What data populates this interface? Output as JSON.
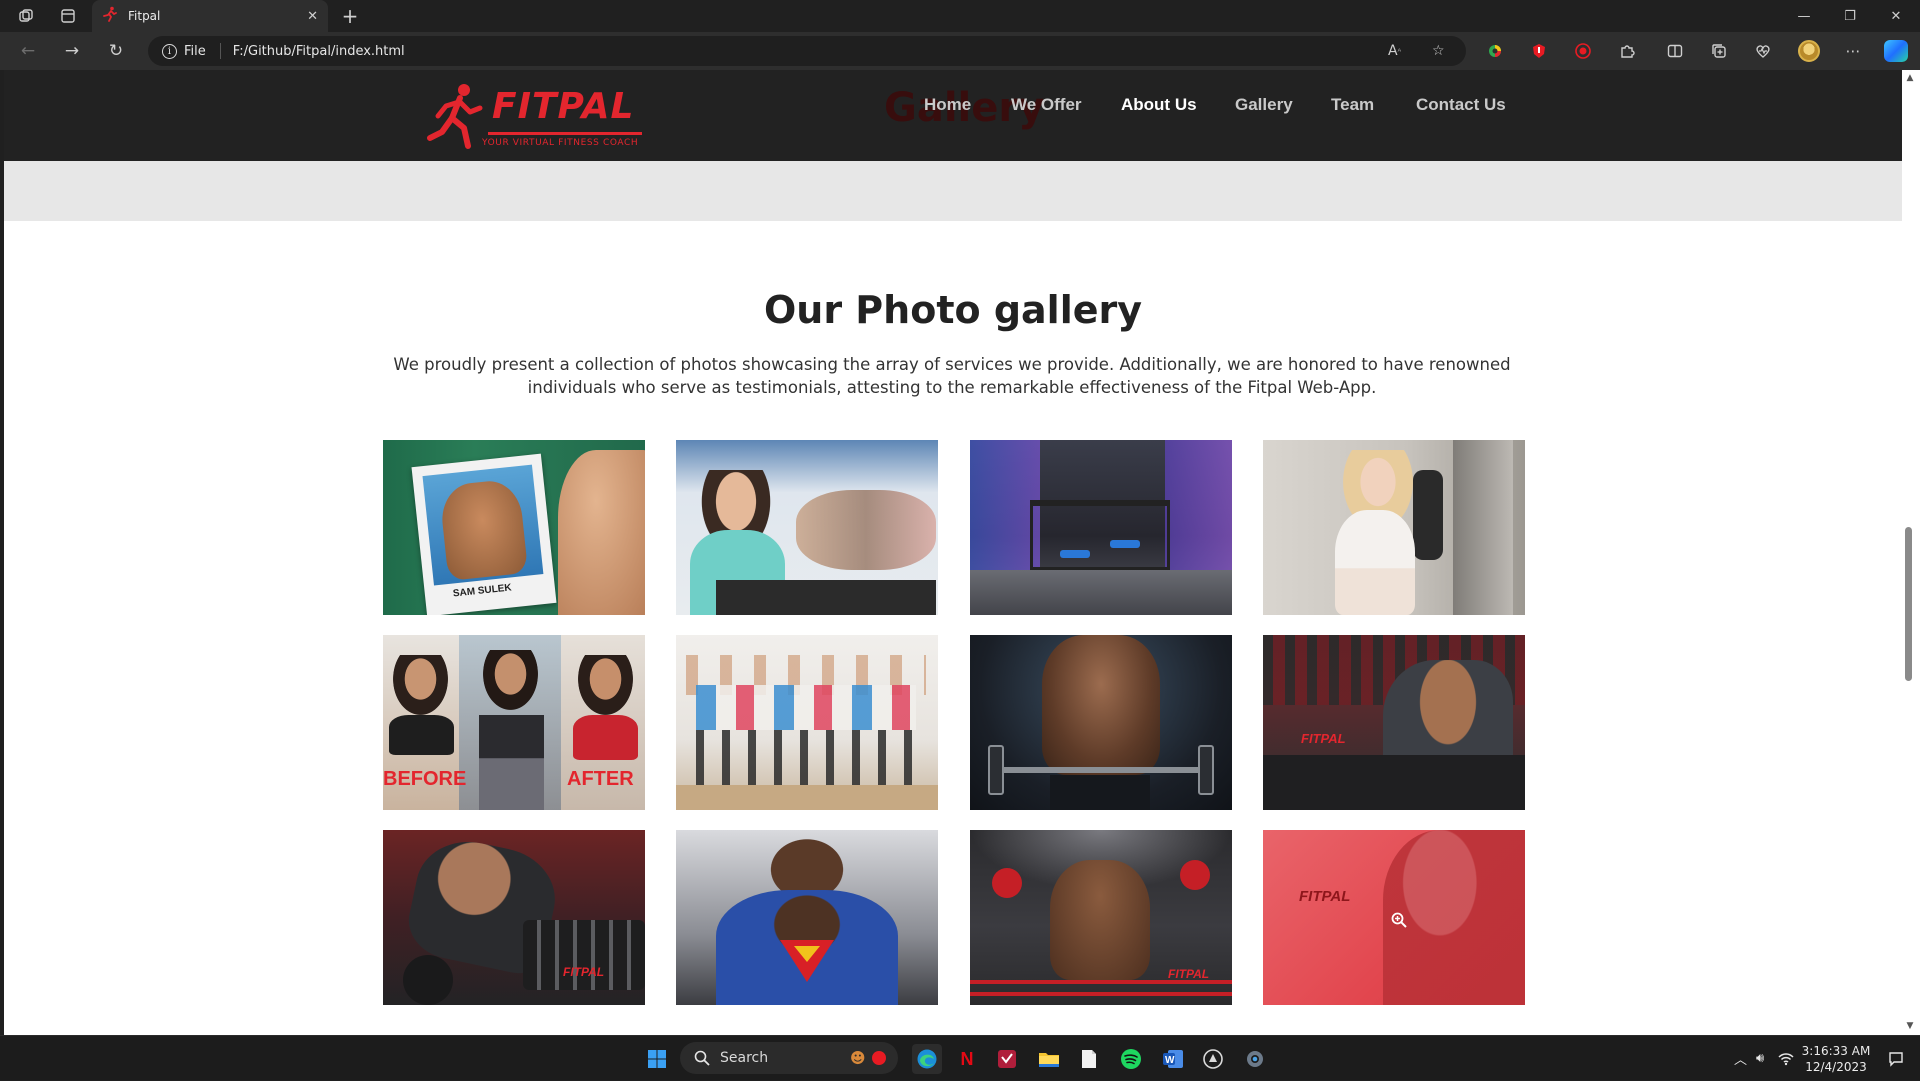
{
  "browser": {
    "tab_title": "Fitpal",
    "address_prefix": "File",
    "url": "F:/Github/Fitpal/index.html"
  },
  "site": {
    "brand": "FITPAL",
    "tagline": "YOUR VIRTUAL FITNESS COACH",
    "ghost_heading": "Gallery",
    "nav": [
      {
        "label": "Home"
      },
      {
        "label": "We Offer"
      },
      {
        "label": "About Us"
      },
      {
        "label": "Gallery"
      },
      {
        "label": "Team"
      },
      {
        "label": "Contact Us"
      }
    ],
    "active_nav": "About Us"
  },
  "gallery": {
    "title": "Our Photo gallery",
    "description": "We proudly present a collection of photos showcasing the array of services we provide. Additionally, we are honored to have renowned individuals who serve as testimonials, attesting to the remarkable effectiveness of the Fitpal Web-App.",
    "photos": [
      {
        "subject": "bodybuilder polaroid comparison",
        "caption": "SAM SULEK"
      },
      {
        "subject": "spin class woman smiling"
      },
      {
        "subject": "gym interior with equipment"
      },
      {
        "subject": "woman in gym with punching bag"
      },
      {
        "subject": "before and after transformation",
        "caption_left": "BEFORE",
        "caption_right": "AFTER"
      },
      {
        "subject": "group aerobics dance class"
      },
      {
        "subject": "muscular man lifting barbell"
      },
      {
        "subject": "athlete on rowing machine",
        "watermark": "FITPAL"
      },
      {
        "subject": "man lifting dumbbell from rack",
        "watermark": "FITPAL"
      },
      {
        "subject": "athlete in superman tank top"
      },
      {
        "subject": "boxer celebrating in ring",
        "watermark": "FITPAL"
      },
      {
        "subject": "boxer with red hover overlay",
        "watermark": "FITPAL"
      }
    ]
  },
  "taskbar": {
    "search_label": "Search",
    "time": "3:16:33 AM",
    "date": "12/4/2023"
  },
  "colors": {
    "brand_red": "#e3262e",
    "header_bg": "#222222",
    "band_grey": "#e7e7e7"
  }
}
